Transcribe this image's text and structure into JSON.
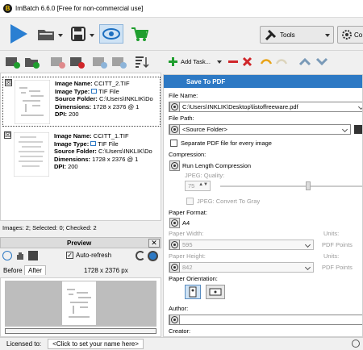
{
  "window": {
    "title": "ImBatch 6.6.0 [Free for non-commercial use]"
  },
  "toolbar": {
    "tools_label": "Tools",
    "co_label": "Co"
  },
  "image_list": {
    "items": [
      {
        "name_label": "Image Name:",
        "name": "CCITT_2.TIF",
        "type_label": "Image Type:",
        "type": "TIF File",
        "folder_label": "Source Folder:",
        "folder": "C:\\Users\\INKLIK\\Do",
        "dims_label": "Dimensions:",
        "dims": "1728 x 2376 @ 1",
        "dpi_label": "DPI:",
        "dpi": "200",
        "checked": true
      },
      {
        "name_label": "Image Name:",
        "name": "CCITT_1.TIF",
        "type_label": "Image Type:",
        "type": "TIF File",
        "folder_label": "Source Folder:",
        "folder": "C:\\Users\\INKLIK\\Do",
        "dims_label": "Dimensions:",
        "dims": "1728 x 2376 @ 1",
        "dpi_label": "DPI:",
        "dpi": "200",
        "checked": true
      }
    ]
  },
  "status_left": "Images: 2; Selected: 0; Checked: 2",
  "preview": {
    "title": "Preview",
    "auto_refresh": "Auto-refresh",
    "tab_before": "Before",
    "tab_after": "After",
    "dims": "1728 x 2376 px"
  },
  "tasks": {
    "add_task_label": "Add Task..."
  },
  "save_pdf": {
    "header": "Save To PDF",
    "file_name_label": "File Name:",
    "file_name": "C:\\Users\\INKLIK\\Desktop\\listoffreeware.pdf",
    "file_path_label": "File Path:",
    "file_path": "<Source Folder>",
    "separate_label": "Separate PDF file for every image",
    "compression_label": "Compression:",
    "compression": "Run Length Compression",
    "jpeg_quality_label": "JPEG: Quality:",
    "jpeg_quality": "75",
    "jpeg_gray_label": "JPEG: Convert To Gray",
    "paper_format_label": "Paper Format:",
    "paper_format": "A4",
    "paper_width_label": "Paper Width:",
    "paper_width": "595",
    "paper_height_label": "Paper Height:",
    "paper_height": "842",
    "units_label": "Units:",
    "units": "PDF Points",
    "orientation_label": "Paper Orientation:",
    "author_label": "Author:",
    "creator_label": "Creator:"
  },
  "statusbar": {
    "licensed_label": "Licensed to:",
    "licensed_value": "<Click to set your name here>"
  },
  "colors": {
    "accent": "#2d79c4",
    "green": "#1f9e2e",
    "red": "#d0262a"
  }
}
